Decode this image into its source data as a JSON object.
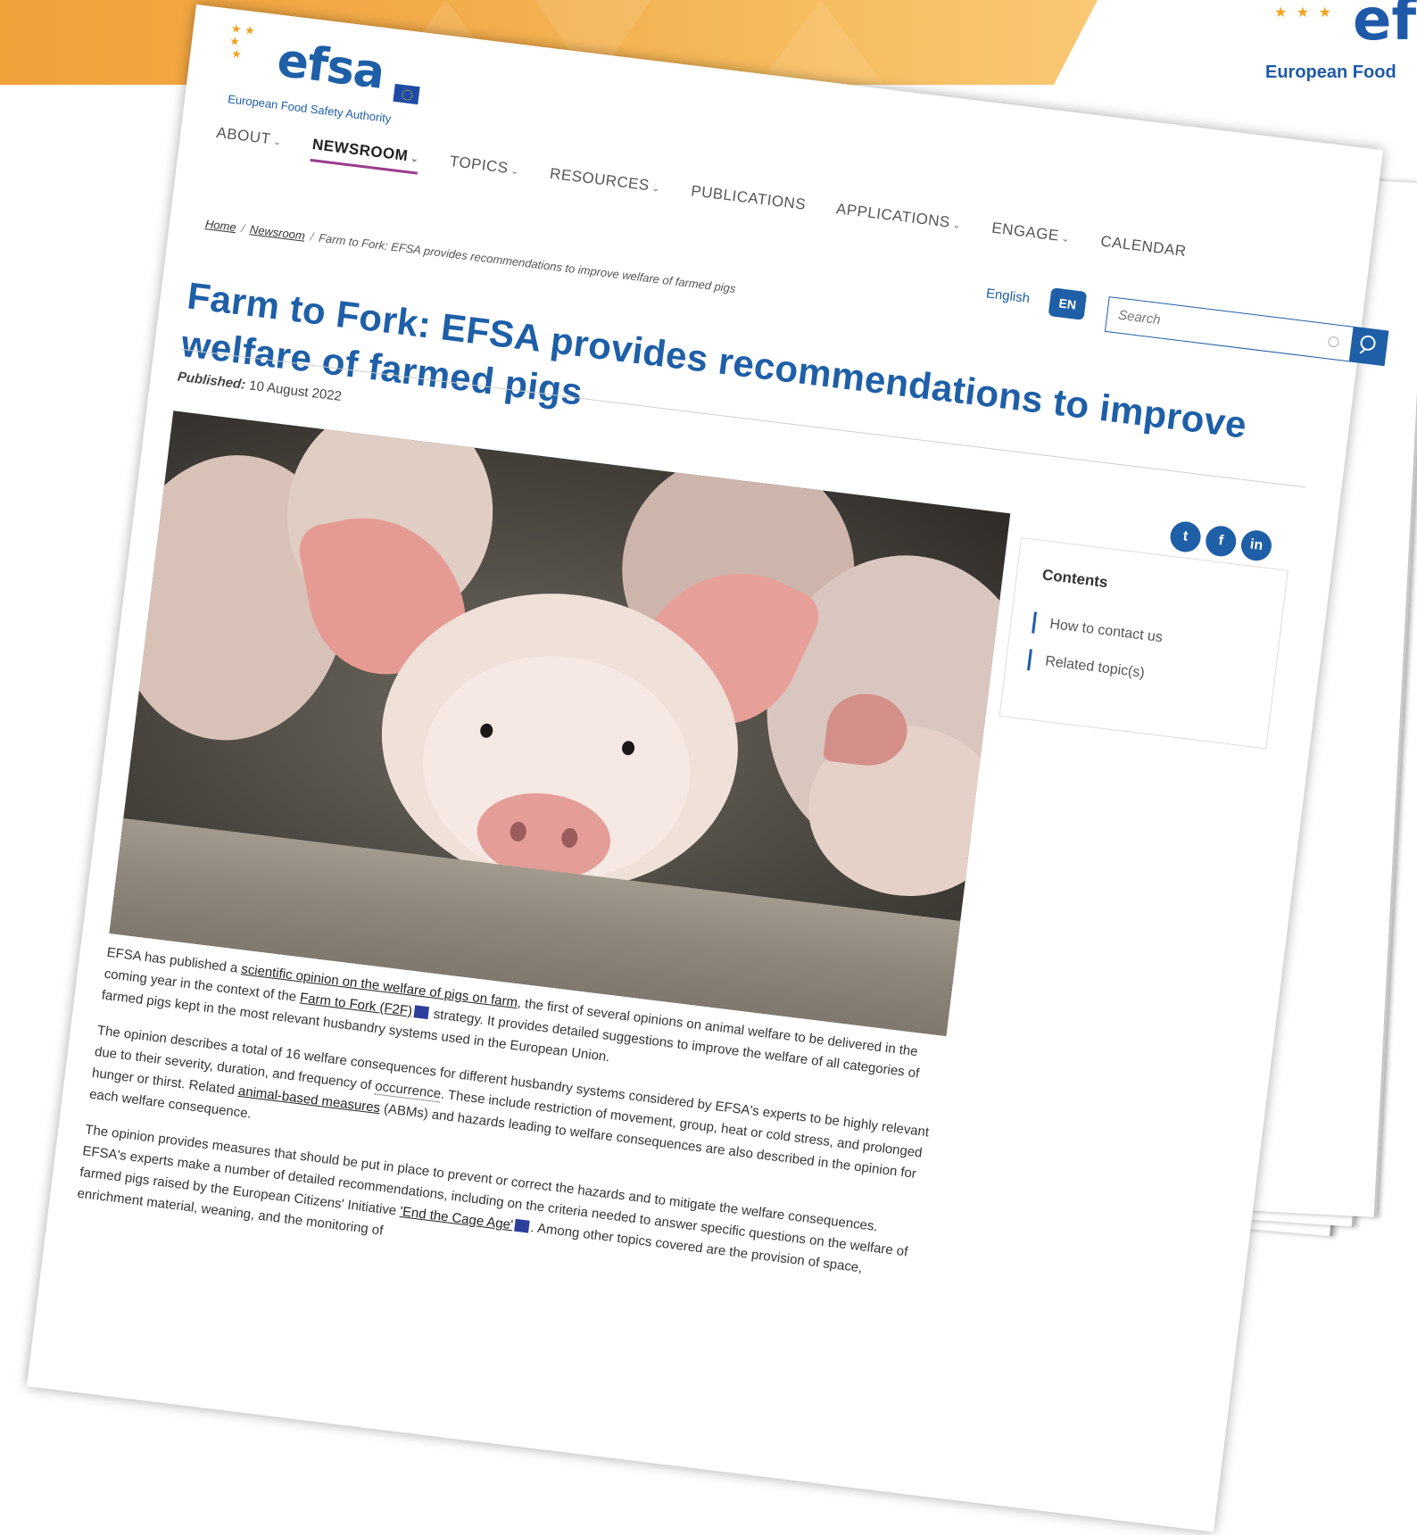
{
  "corner_brand": {
    "logo": "ef",
    "subtitle": "European Food"
  },
  "page": {
    "logo": {
      "text": "efsa",
      "subtitle": "European Food Safety Authority"
    },
    "nav": [
      {
        "label": "ABOUT",
        "dropdown": true
      },
      {
        "label": "NEWSROOM",
        "dropdown": true,
        "active": true
      },
      {
        "label": "TOPICS",
        "dropdown": true
      },
      {
        "label": "RESOURCES",
        "dropdown": true
      },
      {
        "label": "PUBLICATIONS",
        "dropdown": false
      },
      {
        "label": "APPLICATIONS",
        "dropdown": true
      },
      {
        "label": "ENGAGE",
        "dropdown": true
      },
      {
        "label": "CALENDAR",
        "dropdown": false
      }
    ],
    "language": {
      "label": "English",
      "code": "EN"
    },
    "search": {
      "placeholder": "Search"
    },
    "breadcrumb": {
      "home": "Home",
      "newsroom": "Newsroom",
      "current": "Farm to Fork: EFSA provides recommendations to improve welfare of farmed pigs"
    },
    "title": "Farm to Fork: EFSA provides recommendations to improve welfare of farmed pigs",
    "published_label": "Published:",
    "published_date": "10 August 2022",
    "share": {
      "twitter": "t",
      "facebook": "f",
      "linkedin": "in"
    },
    "contents": {
      "title": "Contents",
      "items": [
        "How to contact us",
        "Related topic(s)"
      ]
    },
    "body": {
      "p1": {
        "t1": "EFSA has published a ",
        "link1": "scientific opinion on the welfare of pigs on farm",
        "t2": ", the first of several opinions on animal welfare to be delivered in the coming year in the context of the ",
        "link2": "Farm to Fork (F2F)",
        "t3": " strategy. It provides detailed suggestions to improve the welfare of all categories of farmed pigs kept in the most relevant husbandry systems used in the European Union."
      },
      "p2": {
        "t1": "The opinion describes a total of 16 welfare consequences for different husbandry systems considered by EFSA's experts to be highly relevant due to their severity, duration, and frequency of ",
        "term1": "occurrence",
        "t2": ". These include restriction of movement, group, heat or cold stress, and prolonged hunger or thirst. Related ",
        "link1": "animal-based measures",
        "t3": " (ABMs) and hazards leading to welfare consequences are also described in the opinion for each  welfare consequence."
      },
      "p3": {
        "t1": "The opinion provides measures that should be put in place to prevent or correct the hazards and to mitigate the welfare consequences. EFSA's experts make a number of detailed recommendations, including on the criteria needed to answer specific questions on the welfare of farmed pigs raised by the European Citizens' Initiative ",
        "link1": "'End the Cage Age'",
        "t2": ". Among other topics covered are the provision of space, enrichment material, weaning, and the monitoring of"
      }
    }
  }
}
